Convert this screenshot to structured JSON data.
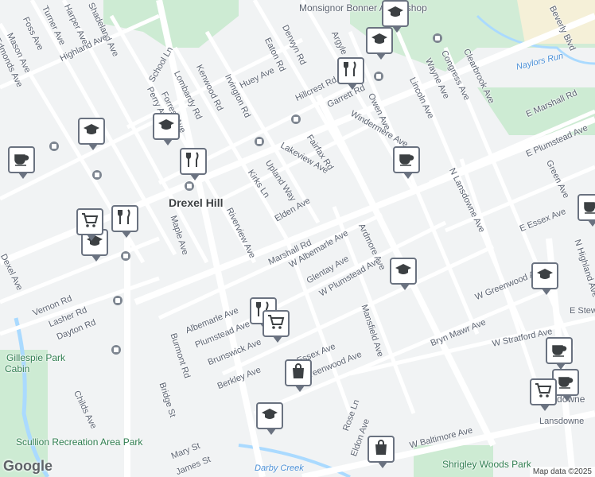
{
  "map": {
    "colors": {
      "background": "#f1f3f4",
      "road": "#ffffff",
      "park": "#cdebd3",
      "campus": "#f5f0d8",
      "water": "#aadaff",
      "pin_border": "#6a7280"
    },
    "town_label": "Drexel Hill",
    "attribution": "Map data ©2025",
    "logo": "Google",
    "streets": [
      "Shadeland Ave",
      "Harper Ave",
      "Turner Ave",
      "Foss Ave",
      "Mason Ave",
      "Highland Ave",
      "Edmonds Ave",
      "School Ln",
      "Perry Ave",
      "Lombardy Rd",
      "Kenwood Rd",
      "Forrest Ave",
      "Irvington Rd",
      "Huey Ave",
      "Eaton Rd",
      "Derwyn Rd",
      "Argyle",
      "Garrett Rd",
      "Hillcrest Rd",
      "Owen Ave",
      "Windermere Ave",
      "Lakeview Ave",
      "Upland Way",
      "Kirks Ln",
      "Fairfax Rd",
      "Marshall Rd",
      "E Marshall Rd",
      "E Plumstead Ave",
      "Green Ave",
      "N Lansdowne Ave",
      "Congress Ave",
      "Wayne Ave",
      "Clearbrook Ave",
      "Lincoln Ave",
      "Beverly Blvd",
      "Riverview Ave",
      "Maple Ave",
      "Elden Ave",
      "W Albemarle Ave",
      "Glentay Ave",
      "Ardmore Ave",
      "W Plumstead Ave",
      "E Essex Ave",
      "Vernon Rd",
      "Lasher Rd",
      "Dayton Rd",
      "Dexel Ave",
      "Albemarle Ave",
      "Plumstead Ave",
      "Brunswick Ave",
      "Berkley Ave",
      "Burmont Rd",
      "Bridge St",
      "Childs Ave",
      "Mansfield Ave",
      "Bryn Mawr Ave",
      "W Greenwood Ave",
      "W Stratford Ave",
      "E Stew",
      "N Highland Ave",
      "Mary St",
      "James St",
      "Rose Ln",
      "Eldon Ave",
      "W Baltimore Ave",
      "Lansdowne",
      "Greenwood Ave",
      "Essex Ave"
    ],
    "places": [
      "Gillespie Park",
      "Cabin",
      "Scullion Recreation Area Park",
      "Naylors Run",
      "Darby Creek",
      "Shrigley Woods Park",
      "Monsignor Bonner Archbishop",
      "Lansdowne"
    ],
    "pins": [
      {
        "type": "school-icon"
      },
      {
        "type": "school-icon"
      },
      {
        "type": "school-icon"
      },
      {
        "type": "school-icon"
      },
      {
        "type": "school-icon"
      },
      {
        "type": "school-icon"
      },
      {
        "type": "school-icon"
      },
      {
        "type": "school-icon"
      },
      {
        "type": "cafe-icon"
      },
      {
        "type": "cafe-icon"
      },
      {
        "type": "cafe-icon"
      },
      {
        "type": "cafe-icon"
      },
      {
        "type": "cafe-icon"
      },
      {
        "type": "restaurant-icon"
      },
      {
        "type": "restaurant-icon"
      },
      {
        "type": "restaurant-icon"
      },
      {
        "type": "restaurant-icon"
      },
      {
        "type": "grocery-icon"
      },
      {
        "type": "grocery-icon"
      },
      {
        "type": "grocery-icon"
      },
      {
        "type": "shopping-bag-icon"
      },
      {
        "type": "shopping-bag-icon"
      }
    ]
  }
}
